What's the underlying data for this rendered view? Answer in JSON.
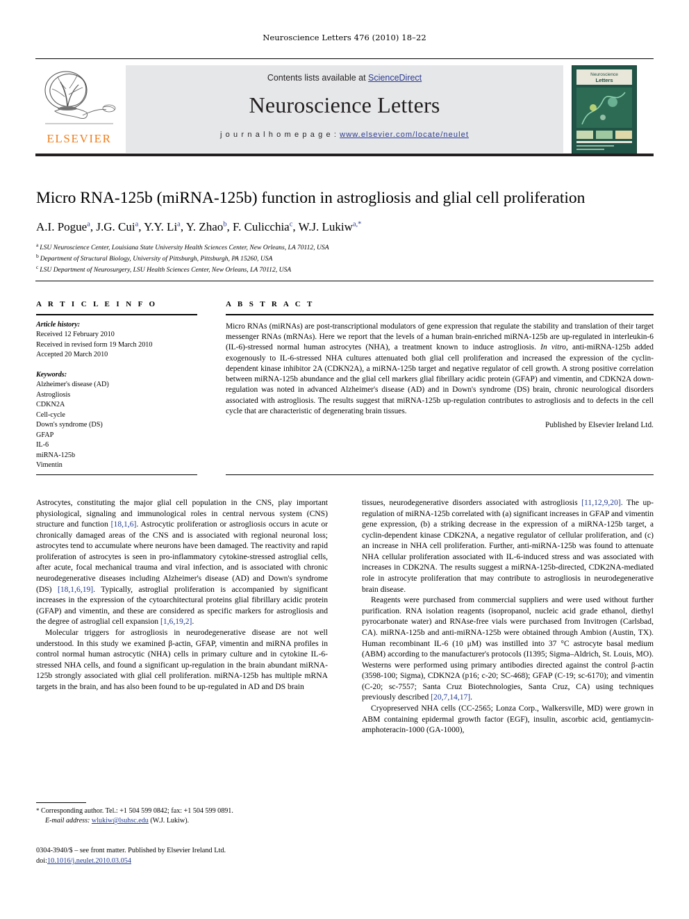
{
  "running_head": "Neuroscience Letters 476 (2010) 18–22",
  "masthead": {
    "contents_prefix": "Contents lists available at ",
    "sciencedirect": "ScienceDirect",
    "journal_title": "Neuroscience Letters",
    "homepage_label": "j o u r n a l   h o m e p a g e :  ",
    "homepage_url": "www.elsevier.com/locate/neulet",
    "publisher_wordmark": "ELSEVIER",
    "cover_title": "Neuroscience Letters"
  },
  "article": {
    "title": "Micro RNA-125b (miRNA-125b) function in astrogliosis and glial cell proliferation",
    "authors": [
      {
        "name": "A.I. Pogue",
        "sup": "a"
      },
      {
        "name": "J.G. Cui",
        "sup": "a"
      },
      {
        "name": "Y.Y. Li",
        "sup": "a"
      },
      {
        "name": "Y. Zhao",
        "sup": "b"
      },
      {
        "name": "F. Culicchia",
        "sup": "c"
      },
      {
        "name": "W.J. Lukiw",
        "sup": "a,*"
      }
    ],
    "affiliations": [
      {
        "mark": "a",
        "text": "LSU Neuroscience Center, Louisiana State University Health Sciences Center, New Orleans, LA 70112, USA"
      },
      {
        "mark": "b",
        "text": "Department of Structural Biology, University of Pittsburgh, Pittsburgh, PA 15260, USA"
      },
      {
        "mark": "c",
        "text": "LSU Department of Neurosurgery, LSU Health Sciences Center, New Orleans, LA 70112, USA"
      }
    ]
  },
  "article_info": {
    "heading": "A R T I C L E   I N F O",
    "history_label": "Article history:",
    "history": [
      "Received 12 February 2010",
      "Received in revised form 19 March 2010",
      "Accepted 20 March 2010"
    ],
    "keywords_label": "Keywords:",
    "keywords": [
      "Alzheimer's disease (AD)",
      "Astrogliosis",
      "CDKN2A",
      "Cell-cycle",
      "Down's syndrome (DS)",
      "GFAP",
      "IL-6",
      "miRNA-125b",
      "Vimentin"
    ]
  },
  "abstract": {
    "heading": "A B S T R A C T",
    "text": "Micro RNAs (miRNAs) are post-transcriptional modulators of gene expression that regulate the stability and translation of their target messenger RNAs (mRNAs). Here we report that the levels of a human brain-enriched miRNA-125b are up-regulated in interleukin-6 (IL-6)-stressed normal human astrocytes (NHA), a treatment known to induce astrogliosis. In vitro, anti-miRNA-125b added exogenously to IL-6-stressed NHA cultures attenuated both glial cell proliferation and increased the expression of the cyclin-dependent kinase inhibitor 2A (CDKN2A), a miRNA-125b target and negative regulator of cell growth. A strong positive correlation between miRNA-125b abundance and the glial cell markers glial fibrillary acidic protein (GFAP) and vimentin, and CDKN2A down-regulation was noted in advanced Alzheimer's disease (AD) and in Down's syndrome (DS) brain, chronic neurological disorders associated with astrogliosis. The results suggest that miRNA-125b up-regulation contributes to astrogliosis and to defects in the cell cycle that are characteristic of degenerating brain tissues.",
    "publisher_note": "Published by Elsevier Ireland Ltd."
  },
  "body": {
    "left_column": [
      "Astrocytes, constituting the major glial cell population in the CNS, play important physiological, signaling and immunological roles in central nervous system (CNS) structure and function [18,1,6]. Astrocytic proliferation or astrogliosis occurs in acute or chronically damaged areas of the CNS and is associated with regional neuronal loss; astrocytes tend to accumulate where neurons have been damaged. The reactivity and rapid proliferation of astrocytes is seen in pro-inflammatory cytokine-stressed astroglial cells, after acute, focal mechanical trauma and viral infection, and is associated with chronic neurodegenerative diseases including Alzheimer's disease (AD) and Down's syndrome (DS) [18,1,6,19]. Typically, astroglial proliferation is accompanied by significant increases in the expression of the cytoarchitectural proteins glial fibrillary acidic protein (GFAP) and vimentin, and these are considered as specific markers for astrogliosis and the degree of astroglial cell expansion [1,6,19,2].",
      "Molecular triggers for astrogliosis in neurodegenerative disease are not well understood. In this study we examined β-actin, GFAP, vimentin and miRNA profiles in control normal human astrocytic (NHA) cells in primary culture and in cytokine IL-6-stressed NHA cells, and found a significant up-regulation in the brain abundant miRNA-125b strongly associated with glial cell proliferation. miRNA-125b has multiple mRNA targets in the brain, and has also been found to be up-regulated in AD and DS brain"
    ],
    "right_column": [
      "tissues, neurodegenerative disorders associated with astrogliosis [11,12,9,20]. The up-regulation of miRNA-125b correlated with (a) significant increases in GFAP and vimentin gene expression, (b) a striking decrease in the expression of a miRNA-125b target, a cyclin-dependent kinase CDK2NA, a negative regulator of cellular proliferation, and (c) an increase in NHA cell proliferation. Further, anti-miRNA-125b was found to attenuate NHA cellular proliferation associated with IL-6-induced stress and was associated with increases in CDK2NA. The results suggest a miRNA-125b-directed, CDK2NA-mediated role in astrocyte proliferation that may contribute to astrogliosis in neurodegenerative brain disease.",
      "Reagents were purchased from commercial suppliers and were used without further purification. RNA isolation reagents (isopropanol, nucleic acid grade ethanol, diethyl pyrocarbonate water) and RNAse-free vials were purchased from Invitrogen (Carlsbad, CA). miRNA-125b and anti-miRNA-125b were obtained through Ambion (Austin, TX). Human recombinant IL-6 (10 μM) was instilled into 37 °C astrocyte basal medium (ABM) according to the manufacturer's protocols (I1395; Sigma–Aldrich, St. Louis, MO). Westerns were performed using primary antibodies directed against the control β-actin (3598-100; Sigma), CDKN2A (p16; c-20; SC-468); GFAP (C-19; sc-6170); and vimentin (C-20; sc-7557; Santa Cruz Biotechnologies, Santa Cruz, CA) using techniques previously described [20,7,14,17].",
      "Cryopreserved NHA cells (CC-2565; Lonza Corp., Walkersville, MD) were grown in ABM containing epidermal growth factor (EGF), insulin, ascorbic acid, gentiamycin-amphoteracin-1000 (GA-1000),"
    ]
  },
  "footnote": {
    "star": "*",
    "corresponding": "Corresponding author. Tel.: +1 504 599 0842; fax: +1 504 599 0891.",
    "email_label": "E-mail address:",
    "email": "wlukiw@lsuhsc.edu",
    "email_suffix": "(W.J. Lukiw)."
  },
  "imprint": {
    "line1": "0304-3940/$ – see front matter. Published by Elsevier Ireland Ltd.",
    "doi_label": "doi:",
    "doi": "10.1016/j.neulet.2010.03.054"
  },
  "colors": {
    "link_blue": "#2b3a8f",
    "citation_blue": "#1f3a93",
    "elsevier_orange": "#f07d1a",
    "band_grey": "#e6e7e9"
  }
}
